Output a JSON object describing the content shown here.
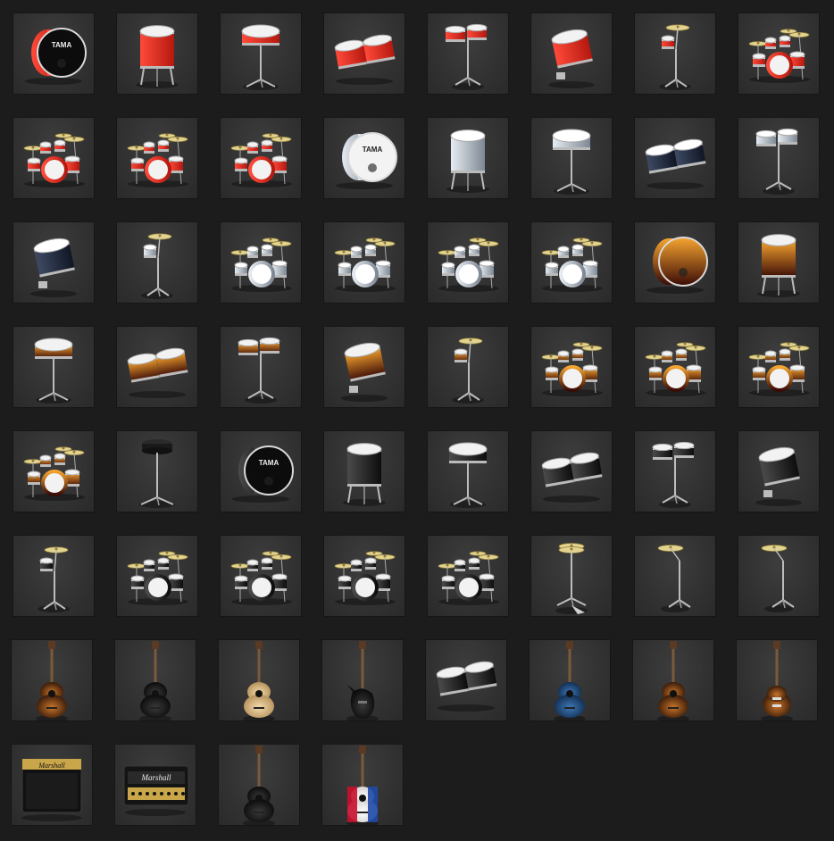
{
  "grid": {
    "background": "#1c1c1c",
    "items": [
      {
        "type": "bass-drum",
        "color": "red",
        "brand": "TAMA"
      },
      {
        "type": "floor-tom",
        "color": "red"
      },
      {
        "type": "snare-stand",
        "color": "red"
      },
      {
        "type": "tom-pair",
        "color": "red"
      },
      {
        "type": "tom-pair-stand",
        "color": "red"
      },
      {
        "type": "rack-tom",
        "color": "red"
      },
      {
        "type": "tom-cymbal-stand",
        "color": "red"
      },
      {
        "type": "drum-kit",
        "color": "red"
      },
      {
        "type": "drum-kit",
        "color": "red"
      },
      {
        "type": "drum-kit",
        "color": "red"
      },
      {
        "type": "drum-kit",
        "color": "red"
      },
      {
        "type": "bass-drum",
        "color": "silver",
        "brand": "TAMA"
      },
      {
        "type": "floor-tom",
        "color": "silver"
      },
      {
        "type": "snare-stand",
        "color": "silver"
      },
      {
        "type": "tom-pair",
        "color": "navy"
      },
      {
        "type": "tom-pair-stand",
        "color": "silver"
      },
      {
        "type": "rack-tom",
        "color": "navy"
      },
      {
        "type": "tom-cymbal-stand",
        "color": "silver"
      },
      {
        "type": "drum-kit",
        "color": "silver"
      },
      {
        "type": "drum-kit",
        "color": "silver"
      },
      {
        "type": "drum-kit",
        "color": "silver"
      },
      {
        "type": "drum-kit",
        "color": "silver"
      },
      {
        "type": "bass-drum",
        "color": "flame"
      },
      {
        "type": "floor-tom",
        "color": "flame"
      },
      {
        "type": "snare-stand",
        "color": "flame"
      },
      {
        "type": "tom-pair",
        "color": "flame"
      },
      {
        "type": "tom-pair-stand",
        "color": "flame"
      },
      {
        "type": "rack-tom",
        "color": "flame"
      },
      {
        "type": "tom-cymbal-stand",
        "color": "flame"
      },
      {
        "type": "drum-kit",
        "color": "flame"
      },
      {
        "type": "drum-kit",
        "color": "flame"
      },
      {
        "type": "drum-kit",
        "color": "flame"
      },
      {
        "type": "drum-kit",
        "color": "flame"
      },
      {
        "type": "drum-throne",
        "color": "black"
      },
      {
        "type": "bass-drum",
        "color": "black",
        "brand": "TAMA"
      },
      {
        "type": "floor-tom",
        "color": "black"
      },
      {
        "type": "snare-stand",
        "color": "black"
      },
      {
        "type": "tom-pair",
        "color": "black"
      },
      {
        "type": "tom-pair-stand",
        "color": "black"
      },
      {
        "type": "rack-tom",
        "color": "black"
      },
      {
        "type": "tom-cymbal-stand",
        "color": "black"
      },
      {
        "type": "drum-kit",
        "color": "black"
      },
      {
        "type": "drum-kit",
        "color": "black"
      },
      {
        "type": "drum-kit",
        "color": "black"
      },
      {
        "type": "drum-kit",
        "color": "black"
      },
      {
        "type": "hihat-stand",
        "color": "gold"
      },
      {
        "type": "cymbal-stand",
        "color": "gold"
      },
      {
        "type": "cymbal-stand",
        "color": "gold"
      },
      {
        "type": "acoustic-guitar",
        "color": "sunburst"
      },
      {
        "type": "acoustic-guitar",
        "color": "black"
      },
      {
        "type": "acoustic-guitar",
        "color": "natural"
      },
      {
        "type": "bass-guitar",
        "color": "black"
      },
      {
        "type": "tom-pair",
        "color": "black"
      },
      {
        "type": "acoustic-guitar",
        "color": "blue"
      },
      {
        "type": "acoustic-guitar",
        "color": "sunburst"
      },
      {
        "type": "electric-guitar",
        "color": "sunburst"
      },
      {
        "type": "amp-combo",
        "color": "black",
        "brand": "Marshall"
      },
      {
        "type": "amp-head",
        "color": "black",
        "brand": "Marshall"
      },
      {
        "type": "acoustic-guitar",
        "color": "black"
      },
      {
        "type": "acoustic-guitar",
        "color": "flag"
      }
    ]
  }
}
